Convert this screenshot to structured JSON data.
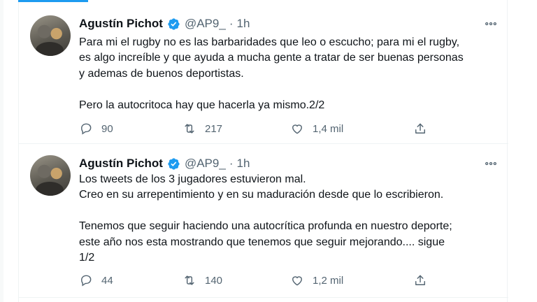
{
  "tweets": [
    {
      "author_name": "Agustín Pichot",
      "handle": "@AP9_",
      "separator": "·",
      "time": "1h",
      "text": "Para mi el rugby no es las barbaridades que leo o escucho; para mi el rugby,\nes algo increíble y que ayuda a mucha gente a tratar de ser buenas personas\ny ademas de buenos deportistas.\n\nPero la autocritoca hay que hacerla ya mismo.2/2",
      "replies": "90",
      "retweets": "217",
      "likes": "1,4 mil"
    },
    {
      "author_name": "Agustín Pichot",
      "handle": "@AP9_",
      "separator": "·",
      "time": "1h",
      "text": "Los tweets de los 3 jugadores estuvieron mal.\nCreo en su arrepentimiento y en su maduración desde que lo escribieron.\n\nTenemos que seguir haciendo una autocrítica profunda en nuestro deporte;\neste año nos esta mostrando que tenemos que seguir mejorando.... sigue\n1/2",
      "replies": "44",
      "retweets": "140",
      "likes": "1,2 mil"
    }
  ],
  "colors": {
    "accent": "#1d9bf0",
    "secondary_text": "#536471",
    "primary_text": "#0f1419",
    "border": "#eff3f4"
  },
  "icons": [
    "verified-badge-icon",
    "more-icon",
    "reply-icon",
    "retweet-icon",
    "like-icon",
    "share-icon"
  ]
}
